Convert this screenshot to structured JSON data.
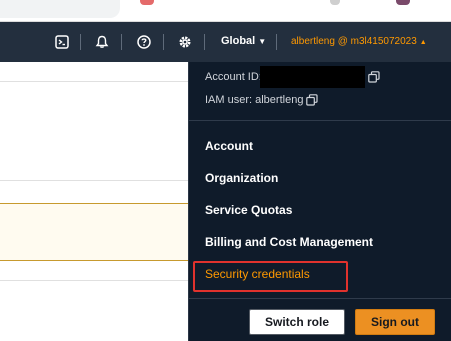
{
  "nav": {
    "icons": [
      "cloudshell-icon",
      "bell-icon",
      "help-icon",
      "gear-icon"
    ],
    "region_label": "Global",
    "account_menu_label": "albertleng @ m3l415072023"
  },
  "account_panel": {
    "account_id_label": "Account ID:",
    "iam_user_label": "IAM user: albertleng",
    "menu_items": [
      "Account",
      "Organization",
      "Service Quotas",
      "Billing and Cost Management",
      "Security credentials"
    ],
    "highlighted_item": "Security credentials",
    "switch_role_label": "Switch role",
    "sign_out_label": "Sign out"
  },
  "colors": {
    "nav_bg": "#232f3e",
    "panel_bg": "#0f1b2a",
    "accent": "#ff9900",
    "highlight_border": "#e0322d",
    "sign_out_bg": "#ec9022"
  }
}
